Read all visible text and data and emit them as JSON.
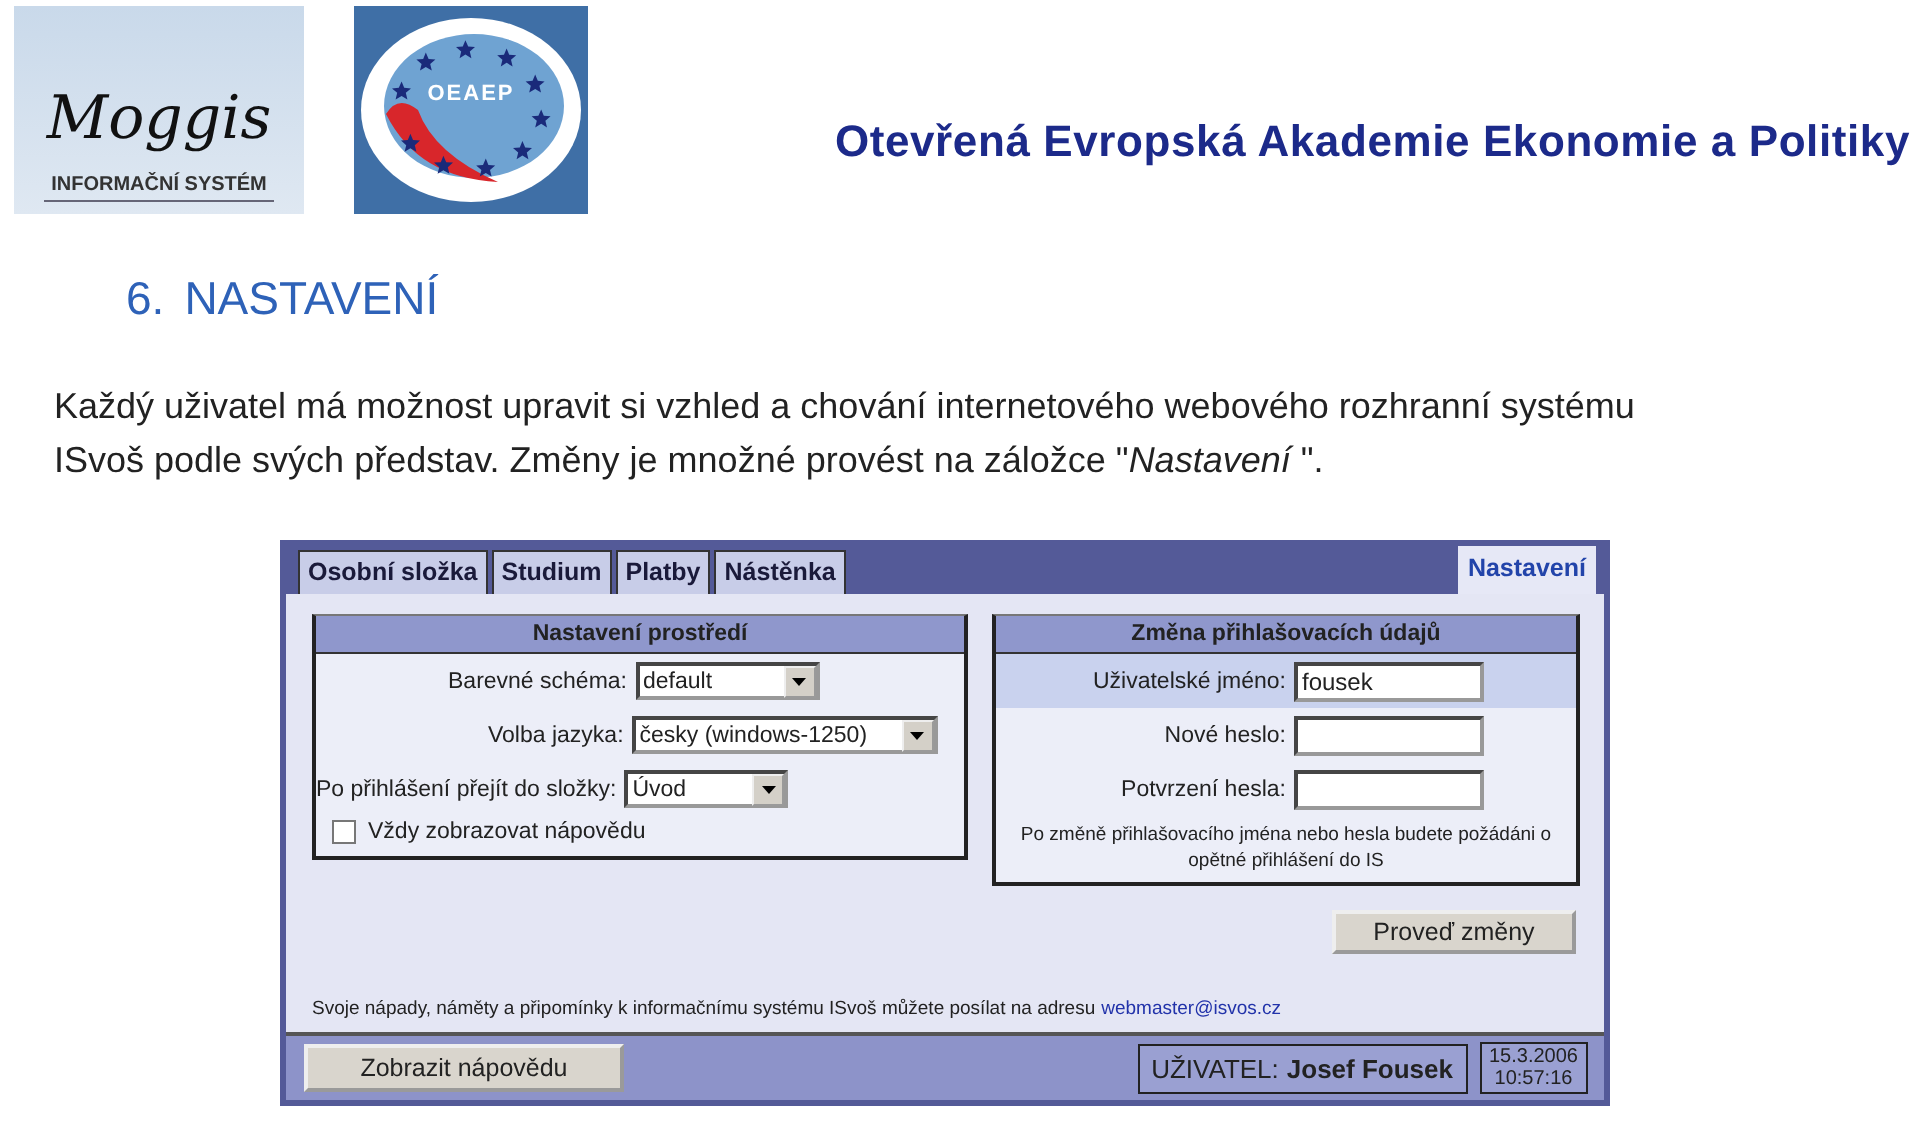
{
  "header": {
    "logo_text": "Moggis",
    "logo_caption": "INFORMAČNÍ SYSTÉM",
    "emblem_text": "OEAEP",
    "title": "Otevřená Evropská Akademie Ekonomie a Politiky"
  },
  "section": {
    "number": "6.",
    "title": "NASTAVENÍ",
    "paragraph": "Každý uživatel má možnost upravit si vzhled a chování internetového webového rozhranní systému ISvoš podle svých představ. Změny je množné provést na záložce \"*Nastavení* \"."
  },
  "screenshot": {
    "tabs_left": [
      {
        "label": "Osobní složka",
        "selected": false
      },
      {
        "label": "Studium",
        "selected": false
      },
      {
        "label": "Platby",
        "selected": false
      },
      {
        "label": "Nástěnka",
        "selected": false
      }
    ],
    "tabs_right": [
      {
        "label": "Nastavení",
        "selected": true
      }
    ],
    "environment_panel": {
      "title": "Nastavení prostředí",
      "fields": [
        {
          "label": "Barevné schéma:",
          "value": "default"
        },
        {
          "label": "Volba jazyka:",
          "value": "česky (windows-1250)"
        },
        {
          "label": "Po přihlášení přejít do složky:",
          "value": "Úvod"
        }
      ],
      "checkbox": {
        "label": "Vždy zobrazovat nápovědu",
        "checked": false
      }
    },
    "login_panel": {
      "title": "Změna přihlašovacích údajů",
      "fields": [
        {
          "label": "Uživatelské jméno:",
          "value": "fousek",
          "highlighted": true
        },
        {
          "label": "Nové heslo:",
          "highlighted": false
        },
        {
          "label": "Potvrzení hesla:",
          "highlighted": false
        }
      ],
      "note": "Po změně přihlašovacího jména nebo hesla budete požádáni o opětné přihlášení do IS"
    },
    "apply_button": "Proveď změny",
    "footer_text": "Svoje nápady, náměty a připomínky k informačnímu systému ISvoš můžete posílat na adresu",
    "footer_email": "webmaster@isvos.cz",
    "help_button": "Zobrazit nápovědu",
    "user_label": "UŽIVATEL:",
    "user_name": "Josef Fousek",
    "date": "15.3.2006",
    "time": "10:57:16"
  }
}
